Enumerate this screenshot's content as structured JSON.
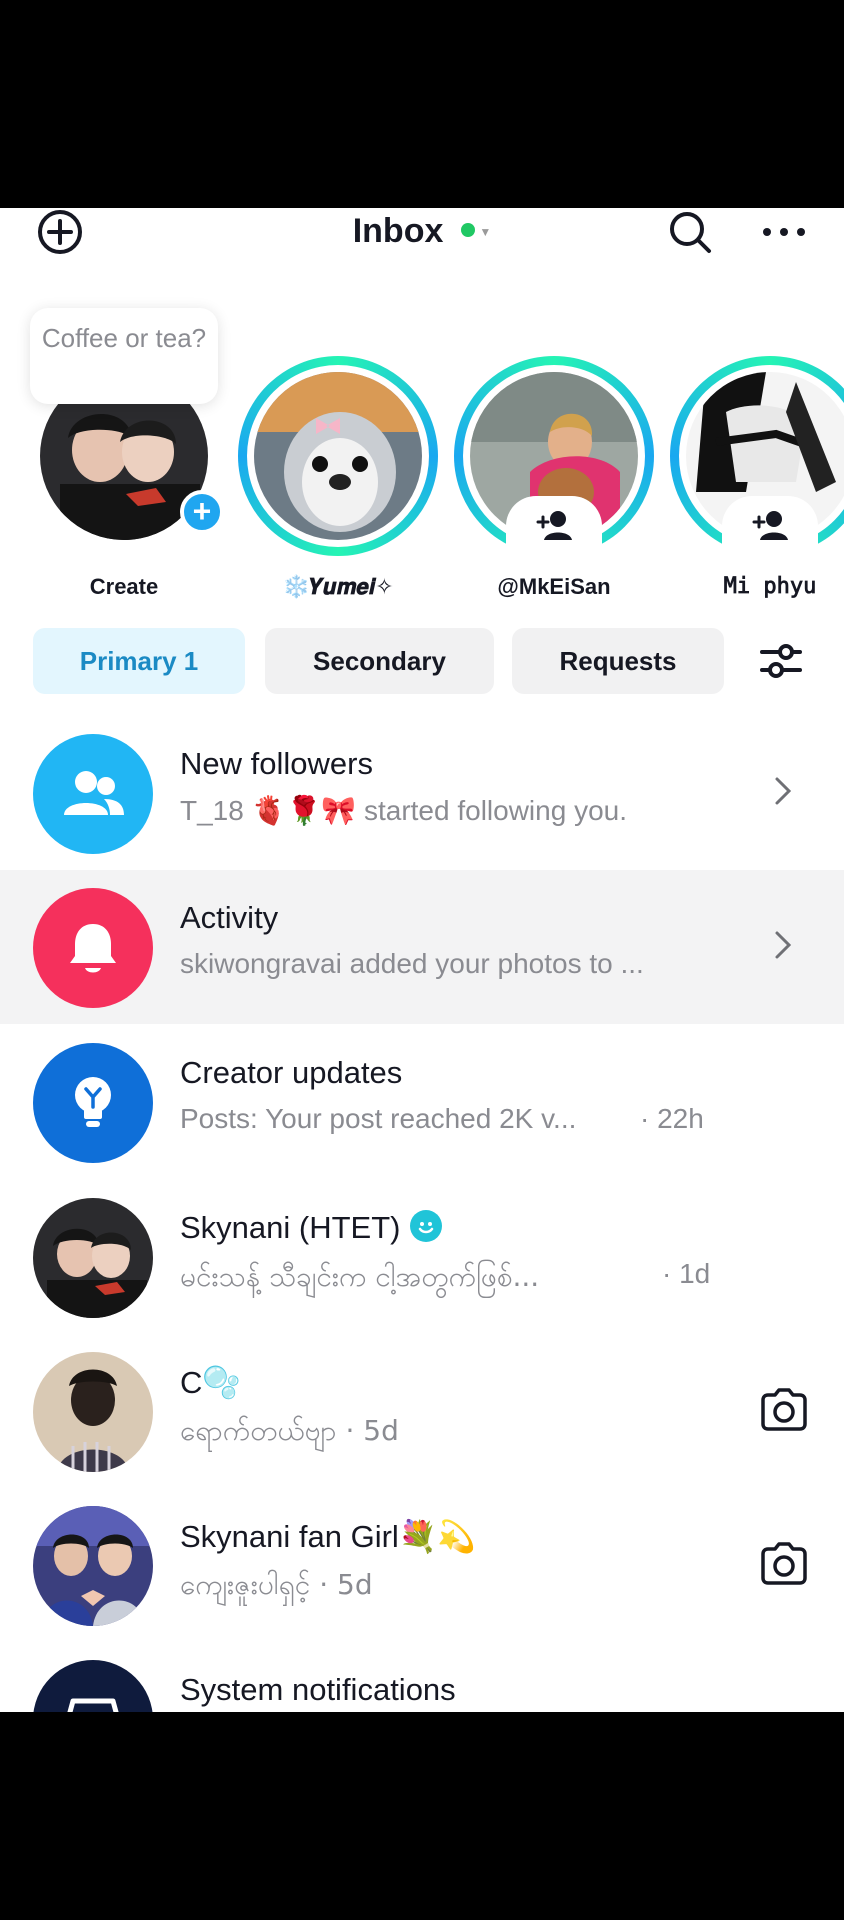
{
  "header": {
    "title": "Inbox",
    "status_color": "#20c864"
  },
  "stories": {
    "bubble_text": "Coffee or tea?",
    "items": [
      {
        "label": "Create"
      },
      {
        "label": "❄️𝒀𝒖𝒎𝒆𝒊✧"
      },
      {
        "label": "@MkEiSan"
      },
      {
        "label": "𝙼𝚒 𝚙𝚑𝚢𝚞"
      }
    ]
  },
  "tabs": [
    {
      "label": "Primary 1",
      "active": true
    },
    {
      "label": "Secondary",
      "active": false
    },
    {
      "label": "Requests",
      "active": false
    }
  ],
  "list": [
    {
      "name": "New followers",
      "sub": "T_18 🫀🌹🎀 started following you.",
      "time": "",
      "icon": "people-icon",
      "color": "#21b6f4"
    },
    {
      "name": "Activity",
      "sub": "skiwongravai added your photos to ...",
      "time": "",
      "icon": "bell-icon",
      "color": "#f5305c"
    },
    {
      "name": "Creator updates",
      "sub": "Posts: Your post reached 2K v...",
      "time": "· 22h",
      "icon": "lightbulb-icon",
      "color": "#0f6fd8"
    },
    {
      "name": "Skynani (HTET)",
      "sub": "မင်းသန့် သီချင်းက ငါ့အတွက်ဖြစ်...",
      "time": "· 1d",
      "icon": "avatar"
    },
    {
      "name": "C🫧",
      "sub": "ရောက်တယ်ဗျာ · 5d",
      "time": "",
      "icon": "avatar"
    },
    {
      "name": "Skynani fan Girl💐💫",
      "sub": "ကျေးဇူးပါရှင့် · 5d",
      "time": "",
      "icon": "avatar"
    },
    {
      "name": "System notifications",
      "sub": "",
      "time": "",
      "icon": "inbox-icon",
      "color": "#0f1b3d"
    }
  ]
}
